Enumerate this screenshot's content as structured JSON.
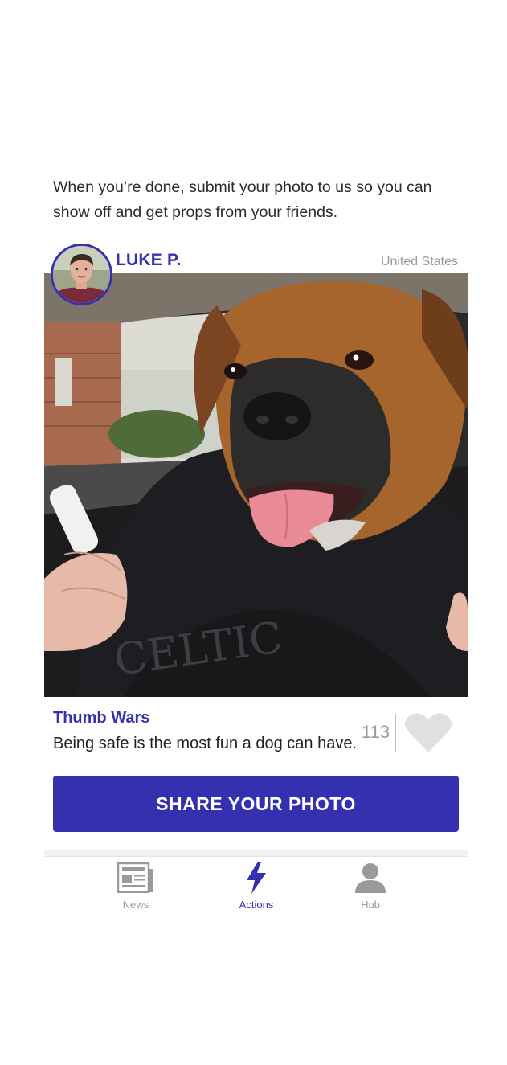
{
  "intro": {
    "text": "When you’re done, submit your photo to us so you can show off and get props from your friends."
  },
  "post": {
    "username": "LUKE P.",
    "location": "United States",
    "title": "Thumb Wars",
    "caption": "Being safe is the most fun a dog can have.",
    "like_count": "113",
    "hoodie_text": "CELTIC"
  },
  "cta": {
    "label": "SHARE YOUR PHOTO"
  },
  "nav": {
    "tabs": [
      {
        "label": "News",
        "icon": "newspaper-icon"
      },
      {
        "label": "Actions",
        "icon": "lightning-bolt-icon"
      },
      {
        "label": "Hub",
        "icon": "person-icon"
      }
    ]
  },
  "colors": {
    "accent": "#3530b0",
    "muted": "#9a9a9a",
    "heart": "#e0e0e0"
  }
}
